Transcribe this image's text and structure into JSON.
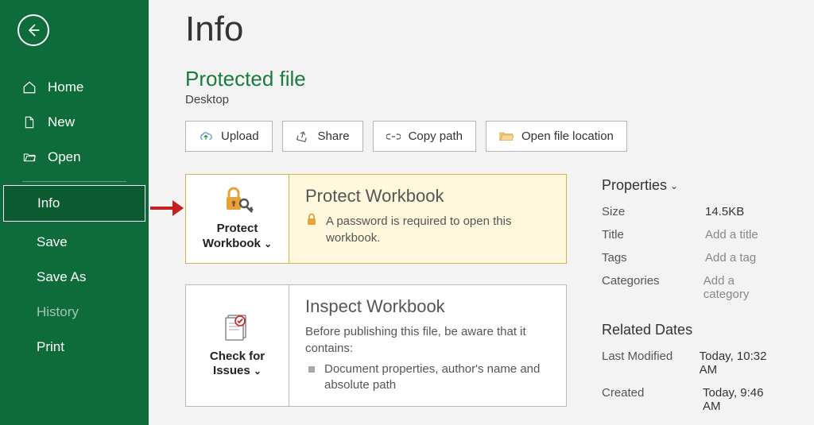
{
  "page_title": "Info",
  "file": {
    "name": "Protected file",
    "location": "Desktop"
  },
  "sidebar": {
    "items": [
      {
        "label": "Home"
      },
      {
        "label": "New"
      },
      {
        "label": "Open"
      },
      {
        "label": "Info"
      },
      {
        "label": "Save"
      },
      {
        "label": "Save As"
      },
      {
        "label": "History"
      },
      {
        "label": "Print"
      }
    ]
  },
  "actions": {
    "upload": "Upload",
    "share": "Share",
    "copy_path": "Copy path",
    "open_loc": "Open file location"
  },
  "protect": {
    "btn": "Protect Workbook",
    "heading": "Protect Workbook",
    "desc": "A password is required to open this workbook."
  },
  "inspect": {
    "btn": "Check for Issues",
    "heading": "Inspect Workbook",
    "preface": "Before publishing this file, be aware that it contains:",
    "item1": "Document properties, author's name and absolute path"
  },
  "props": {
    "header": "Properties",
    "size_l": "Size",
    "size_v": "14.5KB",
    "title_l": "Title",
    "title_v": "Add a title",
    "tags_l": "Tags",
    "tags_v": "Add a tag",
    "cats_l": "Categories",
    "cats_v": "Add a category"
  },
  "dates": {
    "header": "Related Dates",
    "mod_l": "Last Modified",
    "mod_v": "Today, 10:32 AM",
    "cre_l": "Created",
    "cre_v": "Today, 9:46 AM"
  }
}
